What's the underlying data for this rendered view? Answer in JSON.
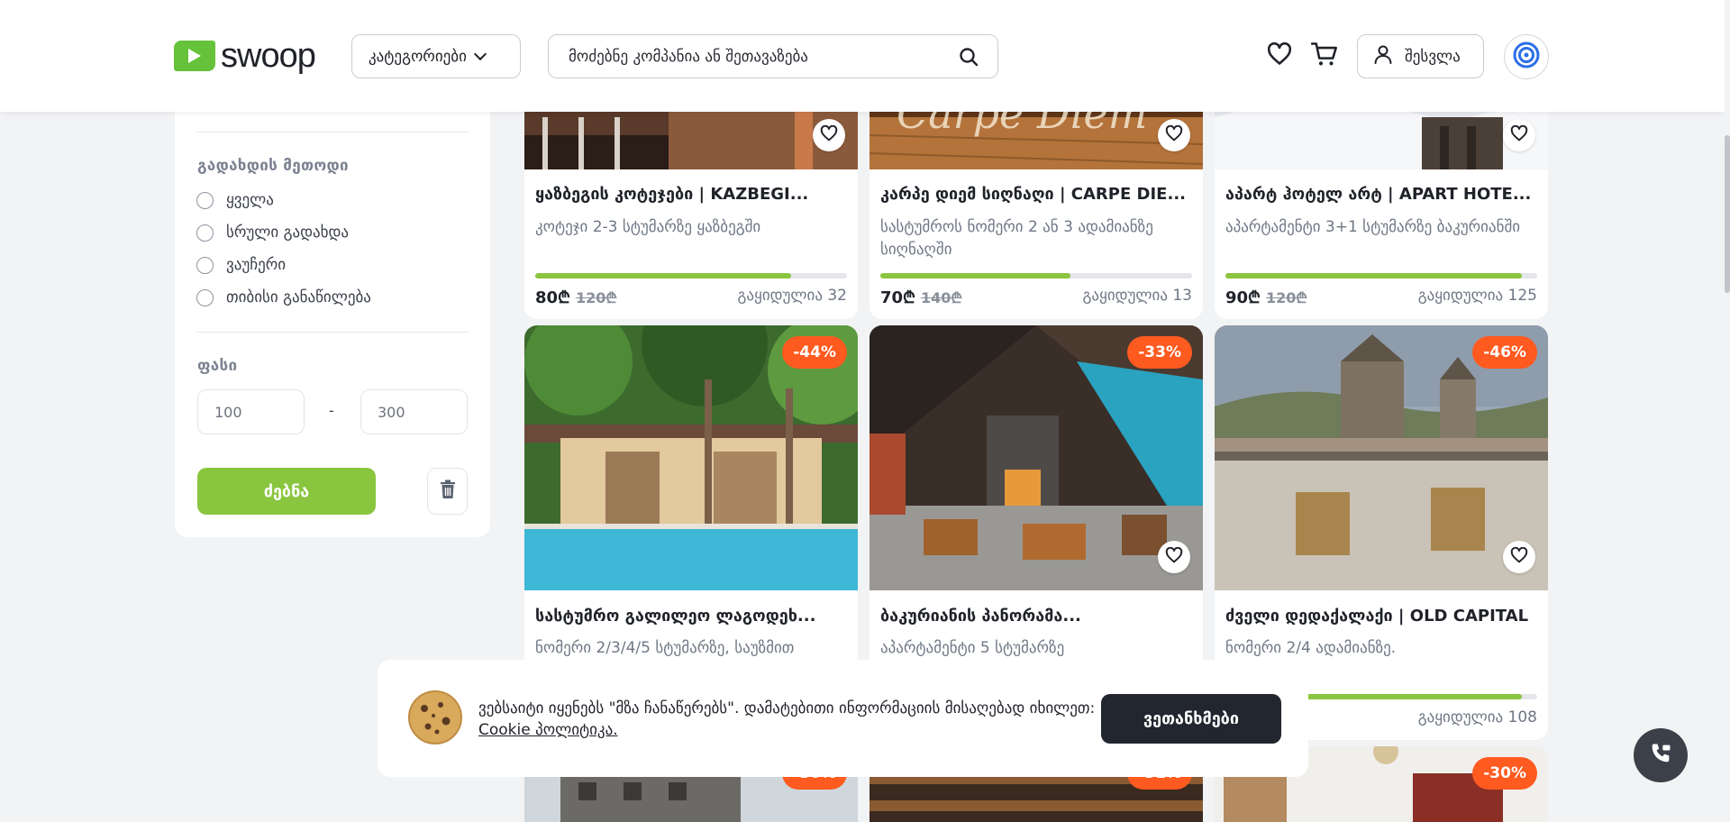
{
  "header": {
    "logo_text": "swoop",
    "categories_label": "კატეგორიები",
    "search_placeholder": "მოძებნე კომპანია ან შეთავაზება",
    "login_label": "შესვლა"
  },
  "sidebar": {
    "payment_title": "გადახდის მეთოდი",
    "payment_options": [
      "ყველა",
      "სრული გადახდა",
      "ვაუჩერი",
      "თიბისი განაწილება"
    ],
    "price_title": "ფასი",
    "price_min": "100",
    "price_max": "300",
    "price_separator": "-",
    "search_button": "ძებნა"
  },
  "cards": [
    {
      "title": "ყაზბეგის კოტეჯები | KAZBEGI...",
      "subtitle": "კოტეჯი 2-3 სტუმარზე ყაზბეგში",
      "price": "80₾",
      "old_price": "120₾",
      "sold": "გაყიდულია 32",
      "progress": 0.82
    },
    {
      "title": "კარპე დიემ სიღნაღი | CARPE DIE...",
      "subtitle": "სასტუმროს ნომერი 2 ან 3 ადამიანზე სიღნაღში",
      "price": "70₾",
      "old_price": "140₾",
      "sold": "გაყიდულია 13",
      "progress": 0.61
    },
    {
      "title": "აპარტ ჰოტელ არტ | APART HOTE...",
      "subtitle": "აპარტამენტი 3+1 სტუმარზე ბაკურიანში",
      "price": "90₾",
      "old_price": "120₾",
      "sold": "გაყიდულია 125",
      "progress": 0.95
    },
    {
      "title": "სასტუმრო გალილეო ლაგოდეხ...",
      "subtitle": "ნომერი 2/3/4/5 სტუმარზე, საუზმით",
      "badge": "-44%"
    },
    {
      "title": "ბაკურიანის პანორამა...",
      "subtitle": "აპარტამენტი 5 სტუმარზე",
      "badge": "-33%"
    },
    {
      "title": "ძველი დედაქალაქი | OLD CAPITAL",
      "subtitle": "ნომერი 2/4 ადამიანზე.",
      "badge": "-46%",
      "sold": "გაყიდულია 108",
      "progress": 0.95
    }
  ],
  "bottom_badges": [
    "-30%",
    "-31%",
    "-30%"
  ],
  "cookie": {
    "text": "ვებსაიტი იყენებს \"მზა ჩანაწერებს\". დამატებითი ინფორმაციის მისაღებად იხილეთ:",
    "link": "Cookie პოლიტიკა.",
    "agree_button": "ვეთანხმები"
  },
  "colors": {
    "accent_green": "#8ac53f",
    "badge_orange": "#ff5a1f",
    "dark_button": "#22262f"
  }
}
